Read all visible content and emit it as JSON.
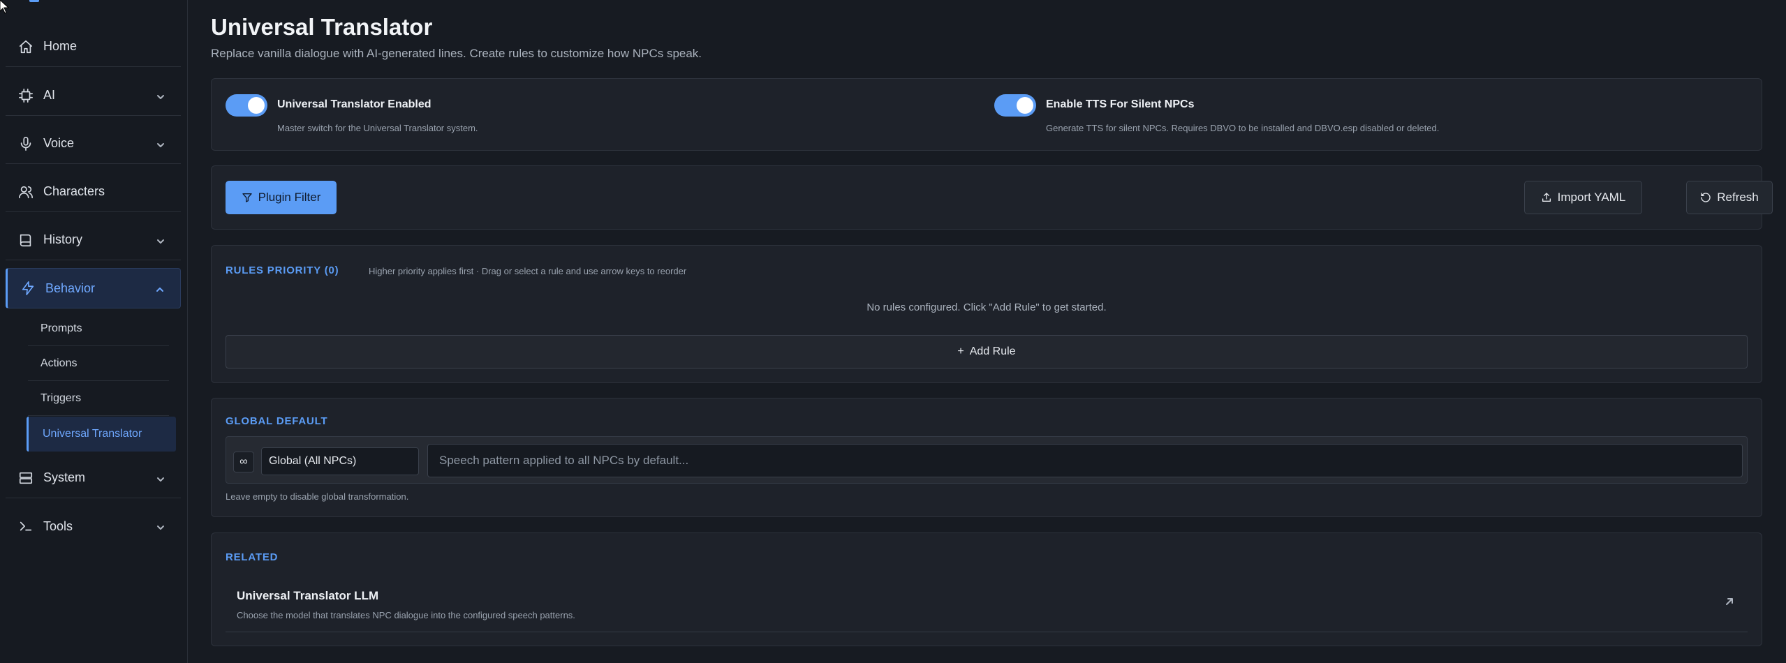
{
  "sidebar": {
    "items": [
      {
        "label": "Home",
        "icon": "home-icon"
      },
      {
        "label": "AI",
        "icon": "cpu-icon"
      },
      {
        "label": "Voice",
        "icon": "microphone-icon"
      },
      {
        "label": "Characters",
        "icon": "users-icon"
      },
      {
        "label": "History",
        "icon": "book-icon"
      },
      {
        "label": "Behavior",
        "icon": "lightning-icon"
      },
      {
        "label": "System",
        "icon": "server-icon"
      },
      {
        "label": "Tools",
        "icon": "terminal-icon"
      }
    ],
    "behavior_sub": [
      {
        "label": "Prompts"
      },
      {
        "label": "Actions"
      },
      {
        "label": "Triggers"
      },
      {
        "label": "Universal Translator"
      }
    ]
  },
  "header": {
    "title": "Universal Translator",
    "subtitle": "Replace vanilla dialogue with AI-generated lines. Create rules to customize how NPCs speak."
  },
  "toggles": [
    {
      "label": "Universal Translator Enabled",
      "description": "Master switch for the Universal Translator system.",
      "on": true
    },
    {
      "label": "Enable TTS For Silent NPCs",
      "description": "Generate TTS for silent NPCs. Requires DBVO to be installed and DBVO.esp disabled or deleted.",
      "on": true
    }
  ],
  "toolbar": {
    "plugin_filter": "Plugin Filter",
    "import_yaml": "Import YAML",
    "refresh": "Refresh"
  },
  "rules": {
    "heading": "RULES PRIORITY (0)",
    "hint": "Higher priority applies first · Drag or select a rule and use arrow keys to reorder",
    "empty": "No rules configured. Click \"Add Rule\" to get started.",
    "add_rule": "Add Rule"
  },
  "global_default": {
    "heading": "GLOBAL DEFAULT",
    "scope_symbol": "∞",
    "scope": "Global (All NPCs)",
    "placeholder": "Speech pattern applied to all NPCs by default...",
    "value": "",
    "help": "Leave empty to disable global transformation."
  },
  "related": {
    "heading": "RELATED",
    "items": [
      {
        "title": "Universal Translator LLM",
        "description": "Choose the model that translates NPC dialogue into the configured speech patterns."
      }
    ]
  },
  "colors": {
    "accent": "#5b9cf5",
    "background": "#171b22",
    "card": "#1e222a"
  }
}
